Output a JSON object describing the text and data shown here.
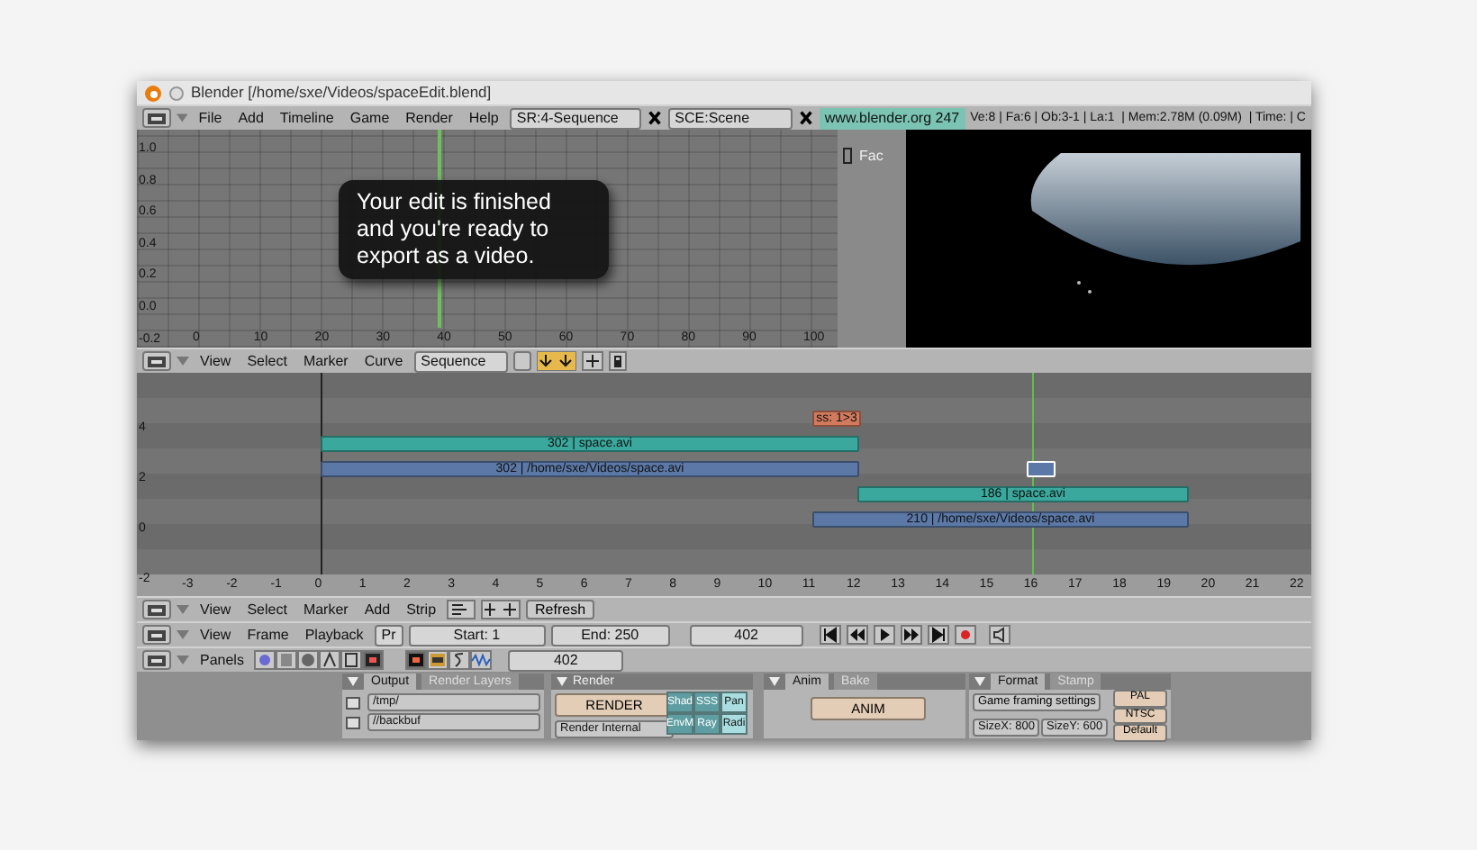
{
  "window": {
    "title": "Blender [/home/sxe/Videos/spaceEdit.blend]"
  },
  "info_header": {
    "menus": [
      "File",
      "Add",
      "Timeline",
      "Game",
      "Render",
      "Help"
    ],
    "screen": "SR:4-Sequence",
    "scene": "SCE:Scene",
    "version": "www.blender.org 247",
    "stats": "Ve:8 | Fa:6 | Ob:3-1 | La:1  | Mem:2.78M (0.09M)  | Time: | C"
  },
  "ipo_editor": {
    "y_ticks": [
      "1.0",
      "0.8",
      "0.6",
      "0.4",
      "0.2",
      "0.0",
      "-0.2"
    ],
    "x_ticks": [
      "0",
      "10",
      "20",
      "30",
      "40",
      "50",
      "60",
      "70",
      "80",
      "90",
      "100"
    ],
    "channel": "Fac",
    "channel_checked": false
  },
  "tooltip": "Your edit is finished and you're ready to export as a video.",
  "ipo_header": {
    "menus": [
      "View",
      "Select",
      "Marker",
      "Curve"
    ],
    "block_type": "Sequence"
  },
  "sequencer": {
    "y_ticks": [
      "4",
      "2",
      "0",
      "-2"
    ],
    "x_ticks": [
      "-3",
      "-2",
      "-1",
      "0",
      "1",
      "2",
      "3",
      "4",
      "5",
      "6",
      "7",
      "8",
      "9",
      "10",
      "11",
      "12",
      "13",
      "14",
      "15",
      "16",
      "17",
      "18",
      "19",
      "20",
      "21",
      "22"
    ],
    "strips": [
      {
        "label": "ss: 1>3",
        "color": "#d27a5e",
        "selected": false
      },
      {
        "label": "302 | space.avi",
        "color": "#3aa89c",
        "selected": false
      },
      {
        "label": "302 | /home/sxe/Videos/space.avi",
        "color": "#5b78a6",
        "selected": false
      },
      {
        "label": "186 | space.avi",
        "color": "#3aa89c",
        "selected": false
      },
      {
        "label": "210 | /home/sxe/Videos/space.avi",
        "color": "#5b78a6",
        "selected": false
      },
      {
        "color": "#5b78a6",
        "selected": true
      }
    ]
  },
  "sequencer_header": {
    "menus": [
      "View",
      "Select",
      "Marker",
      "Add",
      "Strip"
    ],
    "refresh": "Refresh"
  },
  "timeline_header": {
    "menus": [
      "View",
      "Frame",
      "Playback"
    ],
    "preview": "Pr",
    "start": "Start: 1",
    "end": "End: 250",
    "frame": "402"
  },
  "buttons_header": {
    "label": "Panels",
    "context_icons": [
      {
        "kind": "logic",
        "selected": false
      },
      {
        "kind": "script",
        "selected": false
      },
      {
        "kind": "shading",
        "selected": false
      },
      {
        "kind": "object",
        "selected": false
      },
      {
        "kind": "edit",
        "selected": false
      },
      {
        "kind": "scene",
        "selected": true
      }
    ],
    "sub_icons": [
      {
        "kind": "render",
        "selected": true
      },
      {
        "kind": "anim",
        "selected": false
      },
      {
        "kind": "sound",
        "selected": false
      },
      {
        "kind": "wave",
        "selected": false
      }
    ],
    "frame": "402"
  },
  "output_panel": {
    "tabs": [
      {
        "label": "Output",
        "selected": true
      },
      {
        "label": "Render Layers",
        "selected": false
      }
    ],
    "paths": [
      "/tmp/",
      "//backbuf"
    ]
  },
  "render_panel": {
    "title": "Render",
    "render_button": "RENDER",
    "renderer": "Render Internal",
    "toggles": [
      {
        "label": "Shad",
        "on": true
      },
      {
        "label": "SSS",
        "on": true
      },
      {
        "label": "Pan",
        "on": false
      },
      {
        "label": "EnvM",
        "on": true
      },
      {
        "label": "Ray",
        "on": true
      },
      {
        "label": "Radi",
        "on": false
      }
    ]
  },
  "anim_panel": {
    "tabs": [
      {
        "label": "Anim",
        "selected": true
      },
      {
        "label": "Bake",
        "selected": false
      }
    ],
    "anim_button": "ANIM"
  },
  "format_panel": {
    "tabs": [
      {
        "label": "Format",
        "selected": true
      },
      {
        "label": "Stamp",
        "selected": false
      }
    ],
    "game_framing": "Game framing settings",
    "presets": [
      "PAL",
      "NTSC",
      "Default"
    ],
    "size_x": "SizeX: 800",
    "size_y": "SizeY: 600"
  }
}
